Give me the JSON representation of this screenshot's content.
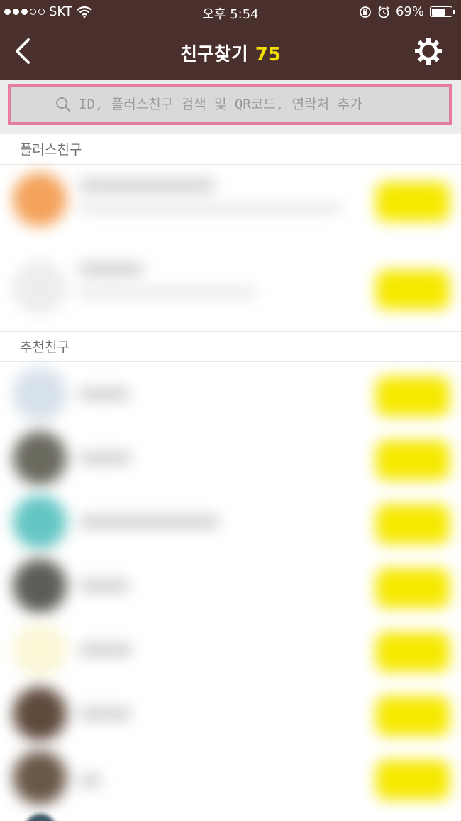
{
  "status_bar": {
    "carrier": "SKT",
    "time": "오후 5:54",
    "battery": "69%",
    "battery_level": 0.69
  },
  "header": {
    "title": "친구찾기",
    "count": "75",
    "back_icon": "chevron-left-icon",
    "settings_icon": "gear-icon"
  },
  "search": {
    "placeholder": "ID, 플러스친구 검색 및 QR코드, 연락처 추가",
    "icon": "search-icon"
  },
  "sections": {
    "plus_friends": {
      "title": "플러스친구"
    },
    "recommended": {
      "title": "추천친구"
    }
  },
  "colors": {
    "header_bg": "#4a302c",
    "count_accent": "#f3e000",
    "search_border": "#e77ca3",
    "add_button": "#f6e900"
  },
  "plus_friend_rows": [
    {
      "avatar_color": "#f4a25a"
    },
    {
      "avatar_color": "#ededed"
    }
  ],
  "recommended_rows": [
    {
      "avatar_color": "#d7e1ea"
    },
    {
      "avatar_color": "#6b6a5f"
    },
    {
      "avatar_color": "#64c6c3"
    },
    {
      "avatar_color": "#5e5c56"
    },
    {
      "avatar_color": "#faf6d6"
    },
    {
      "avatar_color": "#5f4a3c"
    },
    {
      "avatar_color": "#6a5848"
    }
  ]
}
